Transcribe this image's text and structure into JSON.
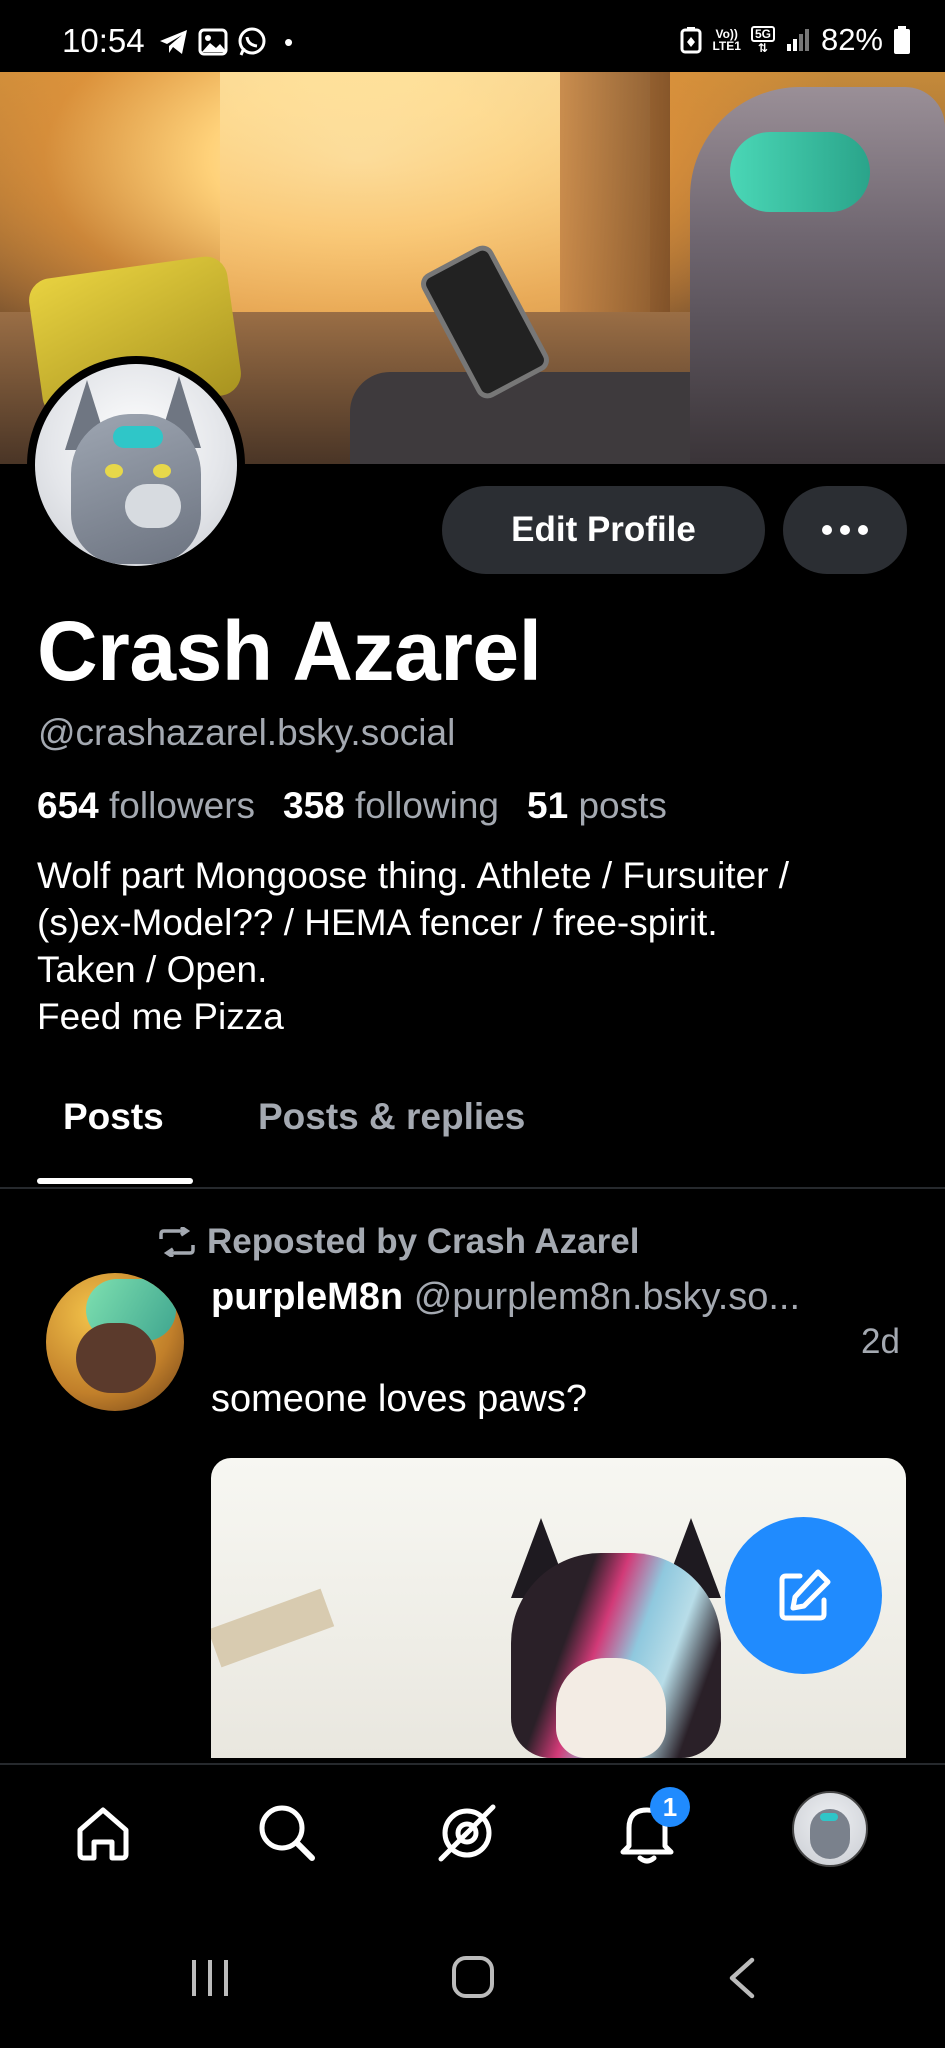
{
  "status_bar": {
    "time": "10:54",
    "dot": "•",
    "net_line1": "Vo))",
    "net_line2": "LTE1",
    "net_5g": "5G",
    "battery": "82%",
    "icons": [
      "telegram-icon",
      "gallery-icon",
      "whatsapp-icon",
      "battery-saver-icon",
      "signal-icon",
      "battery-icon"
    ]
  },
  "profile": {
    "display_name": "Crash Azarel",
    "handle": "@crashazarel.bsky.social",
    "edit_button": "Edit Profile",
    "followers_count": "654",
    "followers_label": "followers",
    "following_count": "358",
    "following_label": "following",
    "posts_count": "51",
    "posts_label": "posts",
    "bio_lines": [
      "Wolf part Mongoose thing. Athlete / Fursuiter /",
      "(s)ex-Model?? / HEMA fencer / free-spirit.",
      "Taken / Open.",
      "Feed me Pizza"
    ]
  },
  "tabs": [
    {
      "label": "Posts",
      "active": true
    },
    {
      "label": "Posts & replies",
      "active": false
    }
  ],
  "feed": [
    {
      "repost_text": "Reposted by Crash Azarel",
      "author_name": "purpleM8n",
      "author_handle": "@purplem8n.bsky.so...",
      "time": "2d",
      "text": "someone loves paws?"
    }
  ],
  "bottom_nav": {
    "items": [
      "home-icon",
      "search-icon",
      "feeds-icon",
      "notifications-icon",
      "profile-avatar"
    ],
    "notification_badge": "1"
  },
  "colors": {
    "accent": "#208bfe",
    "muted_text": "#a4a9b1",
    "button_bg": "#2b2e33"
  }
}
